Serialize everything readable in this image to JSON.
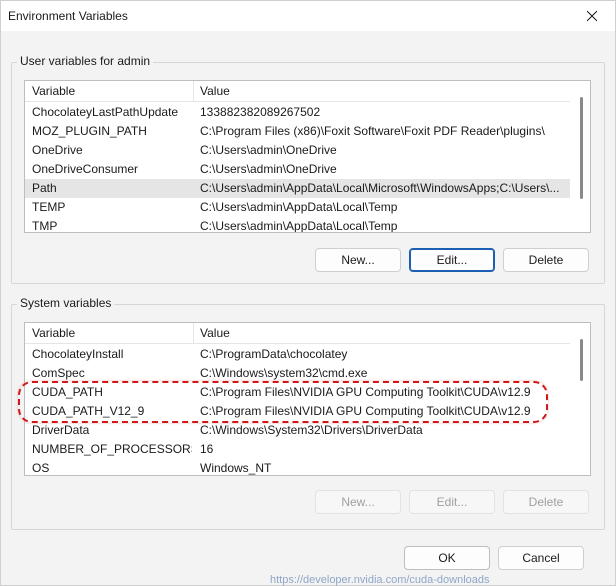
{
  "window": {
    "title": "Environment Variables"
  },
  "user_group": {
    "label": "User variables for admin",
    "columns": [
      "Variable",
      "Value"
    ],
    "rows": [
      {
        "variable": "ChocolateyLastPathUpdate",
        "value": "133882382089267502"
      },
      {
        "variable": "MOZ_PLUGIN_PATH",
        "value": "C:\\Program Files (x86)\\Foxit Software\\Foxit PDF Reader\\plugins\\"
      },
      {
        "variable": "OneDrive",
        "value": "C:\\Users\\admin\\OneDrive"
      },
      {
        "variable": "OneDriveConsumer",
        "value": "C:\\Users\\admin\\OneDrive"
      },
      {
        "variable": "Path",
        "value": "C:\\Users\\admin\\AppData\\Local\\Microsoft\\WindowsApps;C:\\Users\\..."
      },
      {
        "variable": "TEMP",
        "value": "C:\\Users\\admin\\AppData\\Local\\Temp"
      },
      {
        "variable": "TMP",
        "value": "C:\\Users\\admin\\AppData\\Local\\Temp"
      }
    ],
    "selected_row": "Path",
    "buttons": {
      "new": "New...",
      "edit": "Edit...",
      "delete": "Delete"
    }
  },
  "system_group": {
    "label": "System variables",
    "columns": [
      "Variable",
      "Value"
    ],
    "rows": [
      {
        "variable": "ChocolateyInstall",
        "value": "C:\\ProgramData\\chocolatey"
      },
      {
        "variable": "ComSpec",
        "value": "C:\\Windows\\system32\\cmd.exe"
      },
      {
        "variable": "CUDA_PATH",
        "value": "C:\\Program Files\\NVIDIA GPU Computing Toolkit\\CUDA\\v12.9"
      },
      {
        "variable": "CUDA_PATH_V12_9",
        "value": "C:\\Program Files\\NVIDIA GPU Computing Toolkit\\CUDA\\v12.9"
      },
      {
        "variable": "DriverData",
        "value": "C:\\Windows\\System32\\Drivers\\DriverData"
      },
      {
        "variable": "NUMBER_OF_PROCESSORS",
        "value": "16"
      },
      {
        "variable": "OS",
        "value": "Windows_NT"
      }
    ],
    "buttons": {
      "new": "New...",
      "edit": "Edit...",
      "delete": "Delete"
    }
  },
  "footer": {
    "ok": "OK",
    "cancel": "Cancel"
  },
  "background_text": "https://developer.nvidia.com/cuda-downloads",
  "colors": {
    "highlight": "#d01818",
    "focus": "#1a5fb4",
    "selection": "#e5e5e5"
  }
}
